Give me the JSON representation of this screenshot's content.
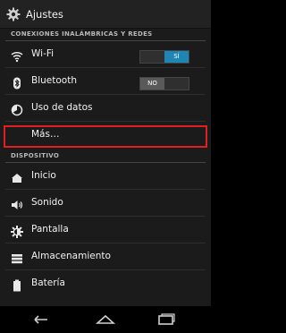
{
  "header": {
    "title": "Ajustes"
  },
  "sections": {
    "wireless": "CONEXIONES INALÁMBRICAS Y REDES",
    "device": "DISPOSITIVO"
  },
  "wireless_items": [
    {
      "label": "Wi-Fi",
      "toggle": "SÍ",
      "toggle_state": "on"
    },
    {
      "label": "Bluetooth",
      "toggle": "NO",
      "toggle_state": "off"
    },
    {
      "label": "Uso de datos"
    },
    {
      "label": "Más…"
    }
  ],
  "device_items": [
    {
      "label": "Inicio"
    },
    {
      "label": "Sonido"
    },
    {
      "label": "Pantalla"
    },
    {
      "label": "Almacenamiento"
    },
    {
      "label": "Batería"
    }
  ],
  "colors": {
    "accent": "#1e85b5",
    "highlight": "#e02020",
    "background": "#1b1b1b"
  },
  "icons": {
    "header": "gear-icon",
    "wireless": [
      "wifi-icon",
      "bluetooth-icon",
      "data-usage-icon"
    ],
    "device": [
      "home-icon",
      "sound-icon",
      "display-icon",
      "storage-icon",
      "battery-icon"
    ],
    "nav": [
      "back-icon",
      "home-nav-icon",
      "recent-apps-icon"
    ]
  }
}
